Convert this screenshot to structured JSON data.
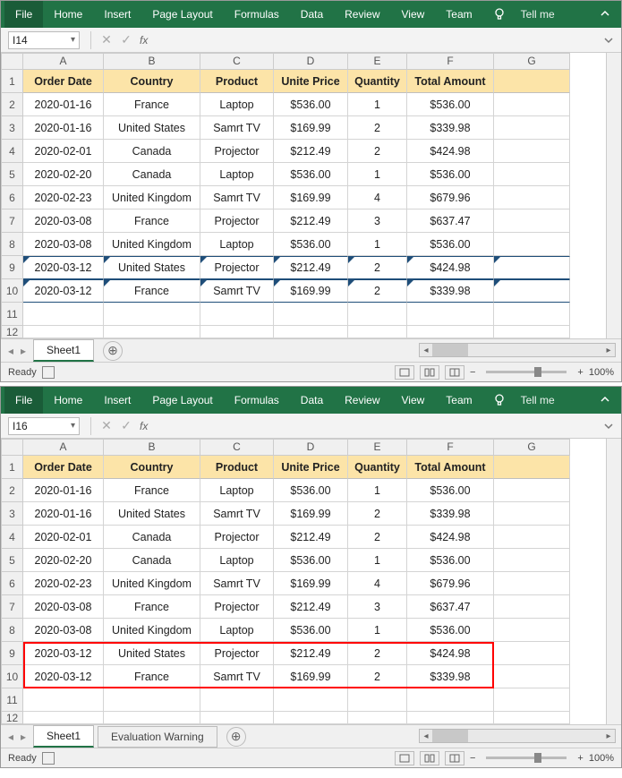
{
  "ribbon": {
    "tabs": [
      "File",
      "Home",
      "Insert",
      "Page Layout",
      "Formulas",
      "Data",
      "Review",
      "View",
      "Team"
    ],
    "tellme": "Tell me"
  },
  "top": {
    "namebox": "I14",
    "sheets": [
      "Sheet1"
    ],
    "ready": "Ready",
    "zoom": "100%"
  },
  "bottom": {
    "namebox": "I16",
    "sheets": [
      "Sheet1",
      "Evaluation Warning"
    ],
    "ready": "Ready",
    "zoom": "100%"
  },
  "cols": [
    "A",
    "B",
    "C",
    "D",
    "E",
    "F",
    "G"
  ],
  "headers": [
    "Order Date",
    "Country",
    "Product",
    "Unite Price",
    "Quantity",
    "Total Amount"
  ],
  "rows": [
    {
      "n": 2,
      "d": [
        "2020-01-16",
        "France",
        "Laptop",
        "$536.00",
        "1",
        "$536.00"
      ]
    },
    {
      "n": 3,
      "d": [
        "2020-01-16",
        "United States",
        "Samrt TV",
        "$169.99",
        "2",
        "$339.98"
      ]
    },
    {
      "n": 4,
      "d": [
        "2020-02-01",
        "Canada",
        "Projector",
        "$212.49",
        "2",
        "$424.98"
      ]
    },
    {
      "n": 5,
      "d": [
        "2020-02-20",
        "Canada",
        "Laptop",
        "$536.00",
        "1",
        "$536.00"
      ]
    },
    {
      "n": 6,
      "d": [
        "2020-02-23",
        "United Kingdom",
        "Samrt TV",
        "$169.99",
        "4",
        "$679.96"
      ]
    },
    {
      "n": 7,
      "d": [
        "2020-03-08",
        "France",
        "Projector",
        "$212.49",
        "3",
        "$637.47"
      ]
    },
    {
      "n": 8,
      "d": [
        "2020-03-08",
        "United Kingdom",
        "Laptop",
        "$536.00",
        "1",
        "$536.00"
      ]
    },
    {
      "n": 9,
      "d": [
        "2020-03-12",
        "United States",
        "Projector",
        "$212.49",
        "2",
        "$424.98"
      ]
    },
    {
      "n": 10,
      "d": [
        "2020-03-12",
        "France",
        "Samrt TV",
        "$169.99",
        "2",
        "$339.98"
      ]
    }
  ],
  "colwidths": {
    "A": 90,
    "B": 108,
    "C": 82,
    "D": 83,
    "E": 66,
    "F": 97,
    "G": 85
  }
}
